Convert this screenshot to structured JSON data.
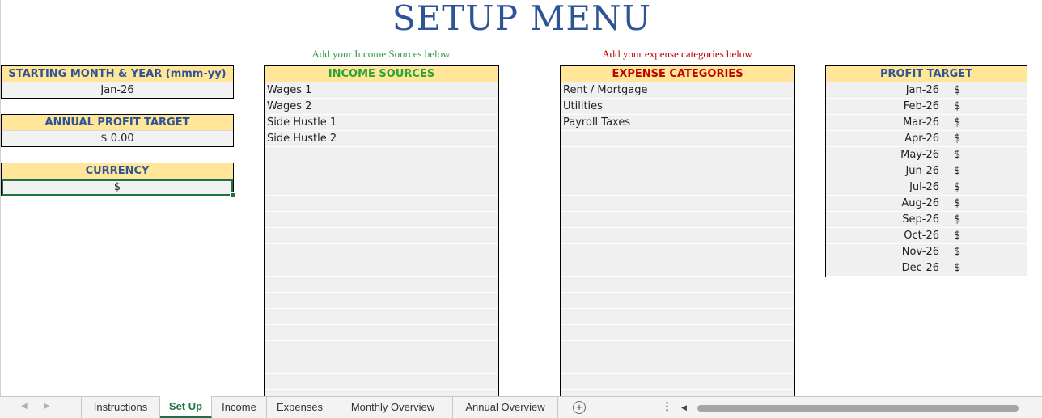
{
  "title": "SETUP MENU",
  "notes": {
    "income": "Add your Income Sources below",
    "expense": "Add your expense categories below"
  },
  "colors": {
    "income_note": "#2e9b3e",
    "expense_note": "#c00000",
    "income_header": "#2aa33a",
    "expense_header": "#c00000",
    "title": "#2f5496",
    "header_fill": "#ffe699"
  },
  "starting": {
    "header": "STARTING MONTH & YEAR (mmm-yy)",
    "value": "Jan-26"
  },
  "annual_profit": {
    "header": "ANNUAL PROFIT TARGET",
    "value": "$ 0.00"
  },
  "currency": {
    "header": "CURRENCY",
    "value": "$"
  },
  "income": {
    "header": "INCOME SOURCES",
    "items": [
      "Wages 1",
      "Wages 2",
      "Side Hustle 1",
      "Side Hustle 2",
      "",
      "",
      "",
      "",
      "",
      "",
      "",
      "",
      "",
      "",
      "",
      "",
      "",
      "",
      "",
      ""
    ]
  },
  "expense": {
    "header": "EXPENSE CATEGORIES",
    "items": [
      "Rent / Mortgage",
      "Utilities",
      "Payroll Taxes",
      "",
      "",
      "",
      "",
      "",
      "",
      "",
      "",
      "",
      "",
      "",
      "",
      "",
      "",
      "",
      "",
      ""
    ]
  },
  "profit_target": {
    "header": "PROFIT TARGET",
    "currency": "$",
    "months": [
      "Jan-26",
      "Feb-26",
      "Mar-26",
      "Apr-26",
      "May-26",
      "Jun-26",
      "Jul-26",
      "Aug-26",
      "Sep-26",
      "Oct-26",
      "Nov-26",
      "Dec-26"
    ]
  },
  "tabs": [
    "Instructions",
    "Set Up",
    "Income",
    "Expenses",
    "Monthly Overview",
    "Annual Overview"
  ],
  "active_tab": "Set Up",
  "icons": {
    "prev": "triangle-left-icon",
    "next": "triangle-right-icon",
    "add": "plus-circle-icon",
    "more": "vertical-dots-icon",
    "scroll_left": "scroll-left-icon"
  }
}
